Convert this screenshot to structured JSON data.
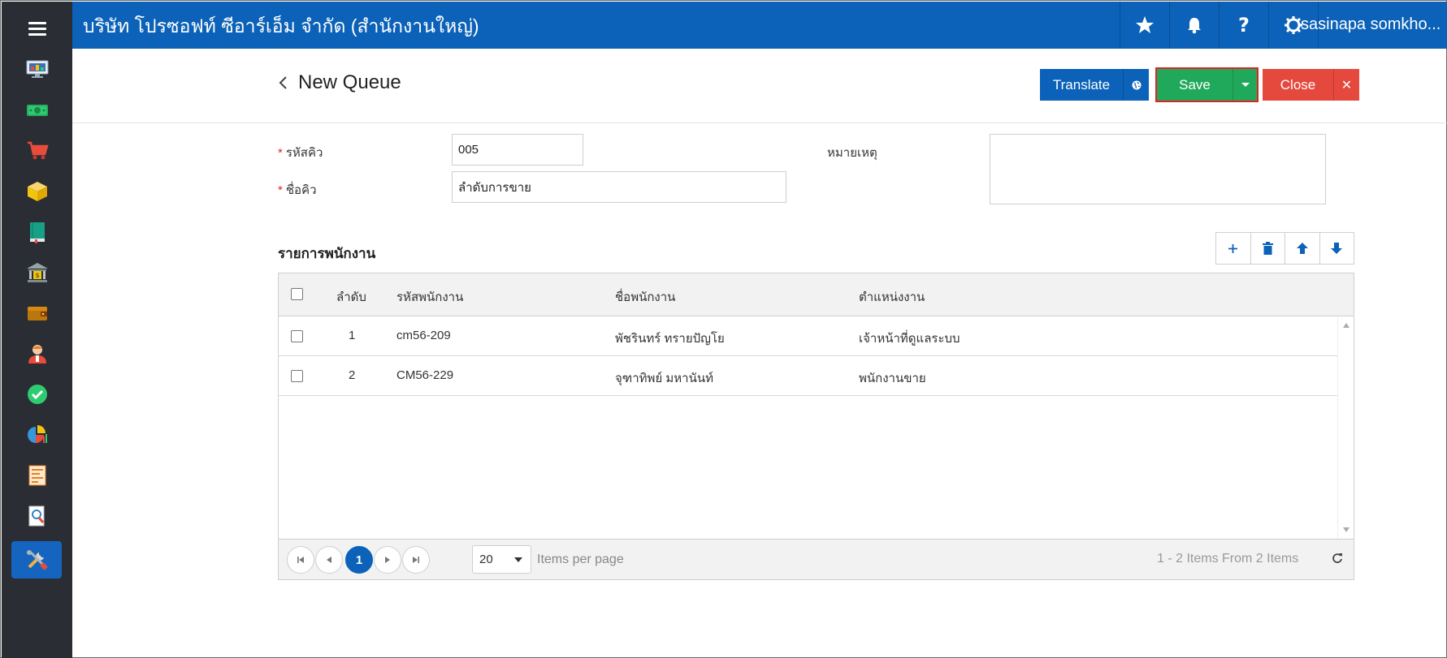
{
  "app": {
    "company": "บริษัท โปรซอฟท์ ซีอาร์เอ็ม จำกัด (สำนักงานใหญ่)",
    "user": "sasinapa somkho...",
    "brand_color": "#0b62b8",
    "sidebar_color": "#2a2d33"
  },
  "sidebar": {
    "items": [
      {
        "icon": "monitor-dashboard-icon"
      },
      {
        "icon": "money-icon"
      },
      {
        "icon": "shopping-cart-icon"
      },
      {
        "icon": "box-icon"
      },
      {
        "icon": "book-icon"
      },
      {
        "icon": "bank-icon"
      },
      {
        "icon": "wallet-icon"
      },
      {
        "icon": "person-icon"
      },
      {
        "icon": "check-circle-icon"
      },
      {
        "icon": "pie-chart-icon"
      },
      {
        "icon": "report-icon"
      },
      {
        "icon": "document-search-icon"
      },
      {
        "icon": "tools-icon",
        "active": true
      }
    ]
  },
  "header": {
    "title": "New Queue",
    "translate_label": "Translate",
    "save_label": "Save",
    "close_label": "Close"
  },
  "form": {
    "queue_code_label": "รหัสคิว",
    "queue_code_value": "005",
    "queue_name_label": "ชื่อคิว",
    "queue_name_value": "ลำดับการขาย",
    "note_label": "หมายเหตุ",
    "note_value": ""
  },
  "employees": {
    "title": "รายการพนักงาน",
    "columns": [
      "ลำดับ",
      "รหัสพนักงาน",
      "ชื่อพนักงาน",
      "ตำแหน่งงาน"
    ],
    "rows": [
      {
        "seq": "1",
        "code": "cm56-209",
        "name": "พัชรินทร์ ทรายปัญโย",
        "position": "เจ้าหน้าที่ดูแลระบบ"
      },
      {
        "seq": "2",
        "code": "CM56-229",
        "name": "จุฑาทิพย์ มหานันท์",
        "position": "พนักงานขาย"
      }
    ]
  },
  "pager": {
    "current_page": "1",
    "page_size": "20",
    "items_per_page_label": "Items per page",
    "info": "1 - 2 Items From 2 Items"
  }
}
